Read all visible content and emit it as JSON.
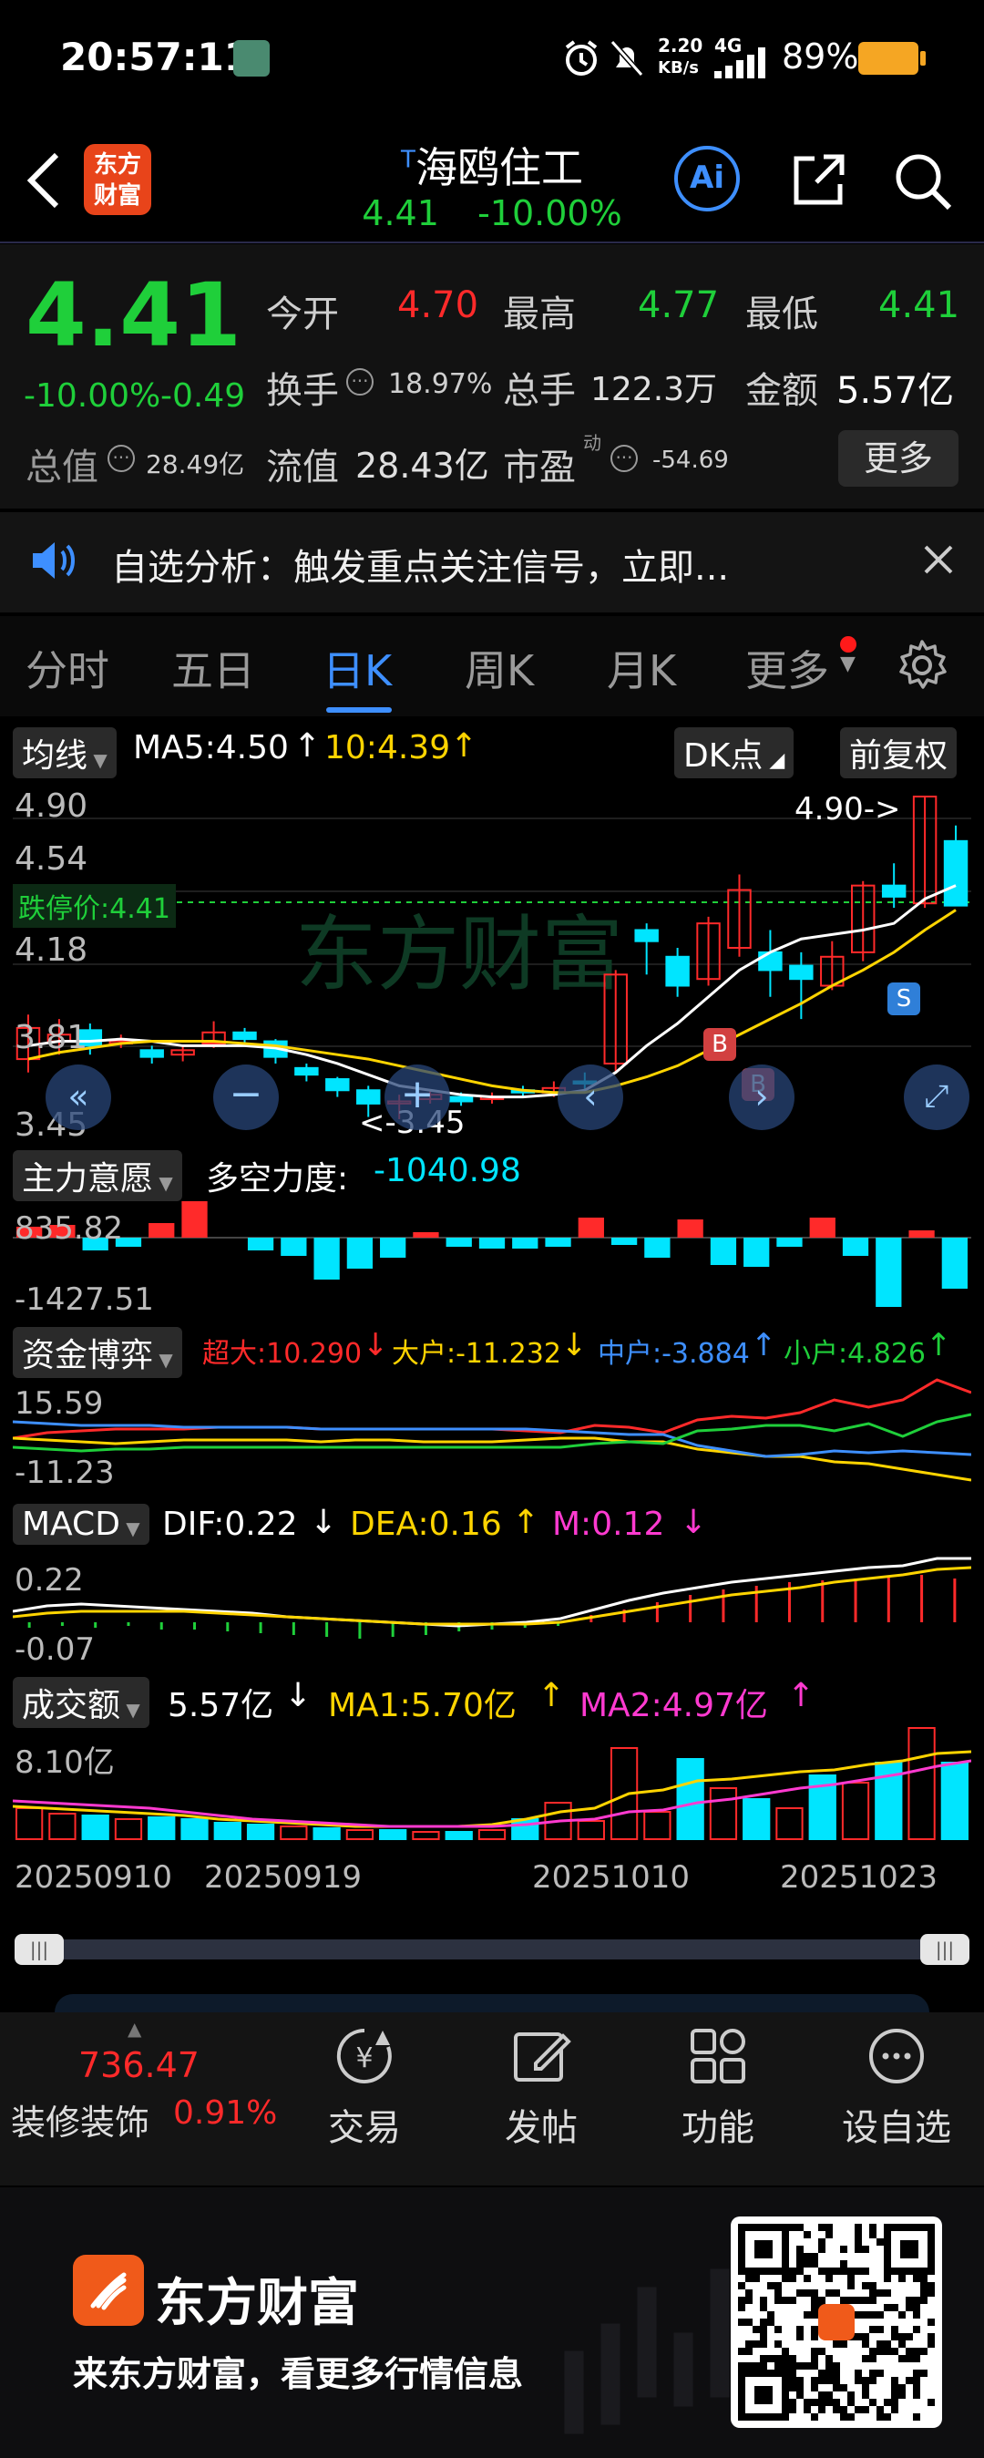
{
  "status": {
    "time": "20:57:11",
    "net_speed": "2.20",
    "net_unit": "KB/s",
    "net_type": "4G",
    "battery": "89%"
  },
  "nav": {
    "logo_text_1": "东方",
    "logo_text_2": "财富",
    "title_prefix": "T",
    "title": "海鸥住工",
    "subtitle_price": "4.41",
    "subtitle_change": "-10.00%",
    "ai_label": "Ai"
  },
  "quote": {
    "price": "4.41",
    "change_pct": "-10.00%",
    "change_amt": "-0.49",
    "open_label": "今开",
    "open": "4.70",
    "high_label": "最高",
    "high": "4.77",
    "low_label": "最低",
    "low": "4.41",
    "turnover_label": "换手",
    "turnover": "18.97%",
    "volume_label": "总手",
    "volume": "122.3万",
    "amount_label": "金额",
    "amount": "5.57亿",
    "mktcap_label": "总值",
    "mktcap": "28.49亿",
    "float_label": "流值",
    "float": "28.43亿",
    "pe_label": "市盈",
    "pe_sup": "动",
    "pe": "-54.69",
    "more": "更多"
  },
  "notice": {
    "text": "自选分析：触发重点关注信号，立即..."
  },
  "tabs": [
    "分时",
    "五日",
    "日K",
    "周K",
    "月K",
    "更多"
  ],
  "active_tab": 2,
  "kline": {
    "ma_label": "均线",
    "ma5": "MA5:4.50",
    "ma10": "10:4.39",
    "dk_label": "DK点",
    "fq_label": "前复权",
    "y_max": "4.90",
    "y_2": "4.54",
    "y_3": "4.18",
    "y_4": "3.81",
    "y_min": "3.45",
    "limit_label": "跌停价:4.41",
    "high_marker": "4.90->",
    "low_marker": "<-3.45",
    "b1": "B",
    "b2": "B",
    "s1": "S",
    "watermark": "东方财富"
  },
  "main_force": {
    "label": "主力意愿",
    "metric": "多空力度:",
    "value": "-1040.98",
    "y_top": "835.82",
    "y_bottom": "-1427.51"
  },
  "fund_game": {
    "label": "资金博弈",
    "super": "超大:10.290",
    "big": "大户:-11.232",
    "mid": "中户:-3.884",
    "small": "小户:4.826",
    "y_top": "15.59",
    "y_bottom": "-11.23"
  },
  "macd": {
    "label": "MACD",
    "dif": "DIF:0.22",
    "dea": "DEA:0.16",
    "m": "M:0.12",
    "y_top": "0.22",
    "y_bottom": "-0.07"
  },
  "volume": {
    "label": "成交额",
    "value": "5.57亿",
    "ma1": "MA1:5.70亿",
    "ma2": "MA2:4.97亿",
    "y_top": "8.10亿"
  },
  "dates": [
    "20250910",
    "20250919",
    "20251010",
    "20251023"
  ],
  "bottom_nav": {
    "index_value": "736.47",
    "index_name": "装修装饰",
    "index_change": "0.91%",
    "items": [
      "交易",
      "发帖",
      "功能",
      "设自选"
    ]
  },
  "promo": {
    "brand": "东方财富",
    "slogan": "来东方财富，看更多行情信息"
  },
  "colors": {
    "up": "#ff2a2a",
    "down": "#00e5ff",
    "green": "#1fcf3a",
    "accent": "#3e8fff",
    "ma5": "#ffffff",
    "ma10": "#ffd400"
  },
  "chart_data": [
    {
      "type": "candlestick",
      "title": "日K",
      "ylim": [
        3.45,
        4.9
      ],
      "x": [
        "20250910",
        "20250919",
        "20251010",
        "20251023"
      ],
      "series": [
        {
          "name": "MA5",
          "values": [
            4.5
          ]
        },
        {
          "name": "MA10",
          "values": [
            4.39
          ]
        }
      ]
    },
    {
      "type": "bar",
      "title": "主力意愿",
      "ylim": [
        -1427.51,
        835.82
      ],
      "series": [
        {
          "name": "多空力度",
          "values": [
            -1040.98
          ]
        }
      ]
    },
    {
      "type": "line",
      "title": "资金博弈",
      "ylim": [
        -11.23,
        15.59
      ],
      "series": [
        {
          "name": "超大",
          "values": [
            10.29
          ]
        },
        {
          "name": "大户",
          "values": [
            -11.232
          ]
        },
        {
          "name": "中户",
          "values": [
            -3.884
          ]
        },
        {
          "name": "小户",
          "values": [
            4.826
          ]
        }
      ]
    },
    {
      "type": "line",
      "title": "MACD",
      "ylim": [
        -0.07,
        0.22
      ],
      "series": [
        {
          "name": "DIF",
          "values": [
            0.22
          ]
        },
        {
          "name": "DEA",
          "values": [
            0.16
          ]
        },
        {
          "name": "M",
          "values": [
            0.12
          ]
        }
      ]
    },
    {
      "type": "bar",
      "title": "成交额",
      "series": [
        {
          "name": "成交额",
          "values": [
            5.57
          ]
        },
        {
          "name": "MA1",
          "values": [
            5.7
          ]
        },
        {
          "name": "MA2",
          "values": [
            4.97
          ]
        }
      ]
    }
  ]
}
